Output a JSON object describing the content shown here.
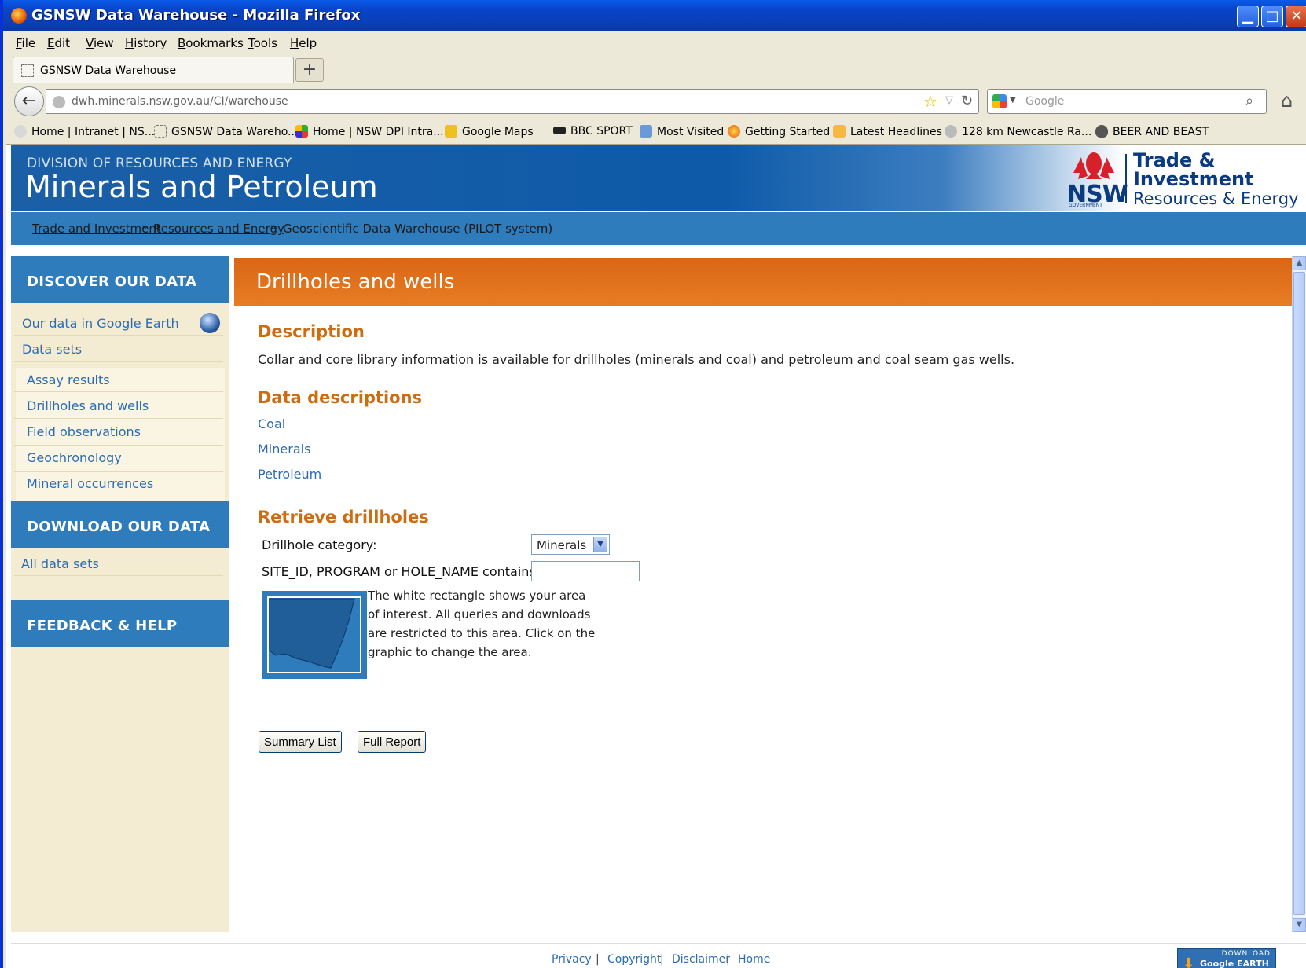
{
  "window": {
    "title": "GSNSW Data Warehouse - Mozilla Firefox"
  },
  "menu": [
    "File",
    "Edit",
    "View",
    "History",
    "Bookmarks",
    "Tools",
    "Help"
  ],
  "tab": {
    "label": "GSNSW Data Warehouse",
    "new_tab": "+"
  },
  "nav": {
    "url": "dwh.minerals.nsw.gov.au/CI/warehouse",
    "search_placeholder": "Google"
  },
  "bookmarks": [
    "Home | Intranet | NS...",
    "GSNSW Data Wareho...",
    "Home | NSW DPI Intra...",
    "Google Maps",
    "BBC SPORT",
    "Most Visited",
    "Getting Started",
    "Latest Headlines",
    "128 km Newcastle Ra...",
    "BEER AND BEAST"
  ],
  "banner": {
    "division": "DIVISION OF RESOURCES AND ENERGY",
    "title": "Minerals and Petroleum",
    "logo_nsw": "NSW",
    "logo_gov": "GOVERNMENT",
    "logo_line1": "Trade &",
    "logo_line2": "Investment",
    "logo_line3": "Resources & Energy"
  },
  "breadcrumb": {
    "items": [
      "Trade and Investment",
      "Resources and Energy"
    ],
    "separator": "»",
    "current": "Geoscientific Data Warehouse (PILOT system)"
  },
  "sidebar": {
    "discover_heading": "DISCOVER OUR DATA",
    "discover_links": [
      "Our data in Google Earth",
      "Data sets"
    ],
    "datasets": [
      "Assay results",
      "Drillholes and wells",
      "Field observations",
      "Geochronology",
      "Mineral occurrences"
    ],
    "download_heading": "DOWNLOAD OUR DATA",
    "download_links": [
      "All data sets"
    ],
    "feedback_heading": "FEEDBACK & HELP"
  },
  "main": {
    "heading": "Drillholes and wells",
    "description_heading": "Description",
    "description_text": "Collar and core library information is available for drillholes (minerals and coal) and petroleum and coal seam gas wells.",
    "data_descriptions_heading": "Data descriptions",
    "data_descriptions": [
      "Coal",
      "Minerals",
      "Petroleum"
    ],
    "retrieve_heading": "Retrieve drillholes",
    "category_label": "Drillhole category:",
    "category_value": "Minerals",
    "contains_label": "SITE_ID, PROGRAM or HOLE_NAME contains:",
    "contains_value": "",
    "map_note": "The white rectangle shows your area of interest. All queries and downloads are restricted to this area. Click on the graphic to change the area.",
    "summary_button": "Summary List",
    "report_button": "Full Report"
  },
  "footer": {
    "links": [
      "Privacy",
      "Copyright",
      "Disclaimer",
      "Home"
    ],
    "separator": "|",
    "ge_download_top": "DOWNLOAD",
    "ge_download_bottom": "Google EARTH"
  },
  "colors": {
    "accent_orange": "#e0701b",
    "header_blue": "#2f7cbc",
    "link_blue": "#2b6cb4",
    "sidebar_bg": "#f3ecd3"
  }
}
